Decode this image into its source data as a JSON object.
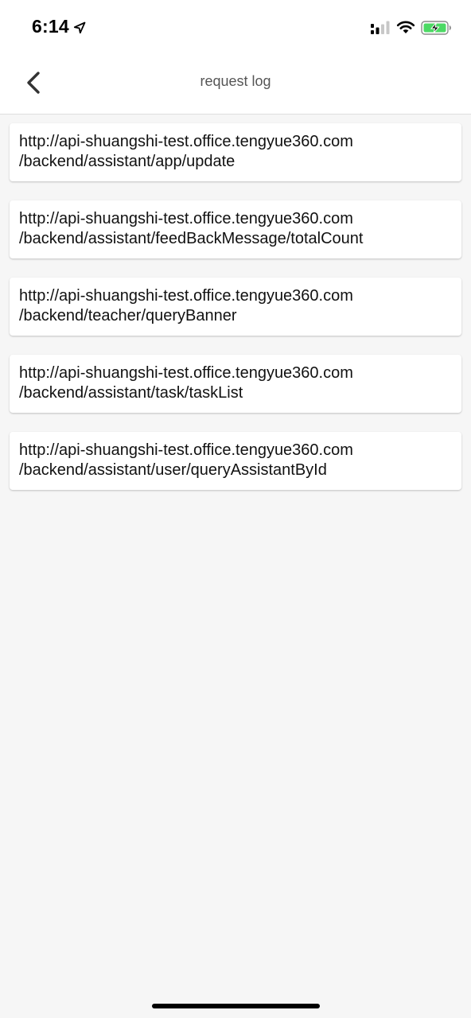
{
  "status_bar": {
    "time": "6:14",
    "icons": [
      "location-arrow-icon",
      "cellular-signal-icon",
      "wifi-icon",
      "battery-charging-icon"
    ],
    "battery_color": "#4cd964"
  },
  "nav": {
    "title": "request log",
    "back_icon": "chevron-left-icon"
  },
  "requests": [
    {
      "host": "http://api-shuangshi-test.office.tengyue360.com",
      "path": "/backend/assistant/app/update"
    },
    {
      "host": "http://api-shuangshi-test.office.tengyue360.com",
      "path": "/backend/assistant/feedBackMessage/totalCount"
    },
    {
      "host": "http://api-shuangshi-test.office.tengyue360.com",
      "path": "/backend/teacher/queryBanner"
    },
    {
      "host": "http://api-shuangshi-test.office.tengyue360.com",
      "path": "/backend/assistant/task/taskList"
    },
    {
      "host": "http://api-shuangshi-test.office.tengyue360.com",
      "path": "/backend/assistant/user/queryAssistantById"
    }
  ]
}
